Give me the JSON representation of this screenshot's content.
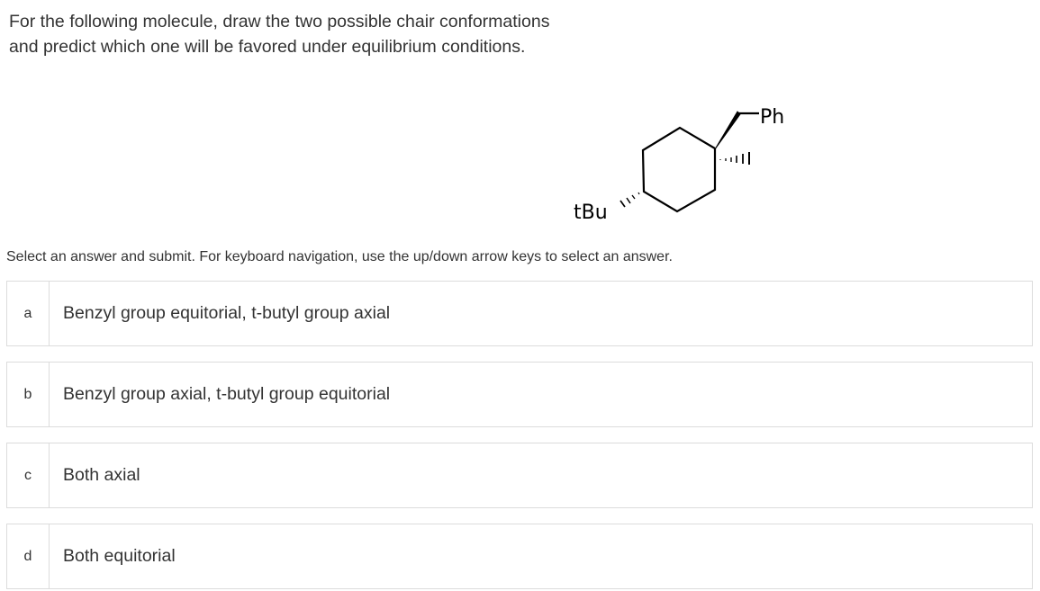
{
  "question": {
    "line1": "For the following molecule, draw the two possible chair conformations",
    "line2": "and predict which one will be favored under equilibrium conditions."
  },
  "molecule": {
    "substituent_top": "Ph",
    "substituent_left": "tBu"
  },
  "instruction": "Select an answer and submit. For keyboard navigation, use the up/down arrow keys to select an answer.",
  "options": [
    {
      "letter": "a",
      "text": "Benzyl group equitorial, t-butyl group axial"
    },
    {
      "letter": "b",
      "text": "Benzyl group axial, t-butyl group equitorial"
    },
    {
      "letter": "c",
      "text": "Both axial"
    },
    {
      "letter": "d",
      "text": "Both equitorial"
    }
  ]
}
